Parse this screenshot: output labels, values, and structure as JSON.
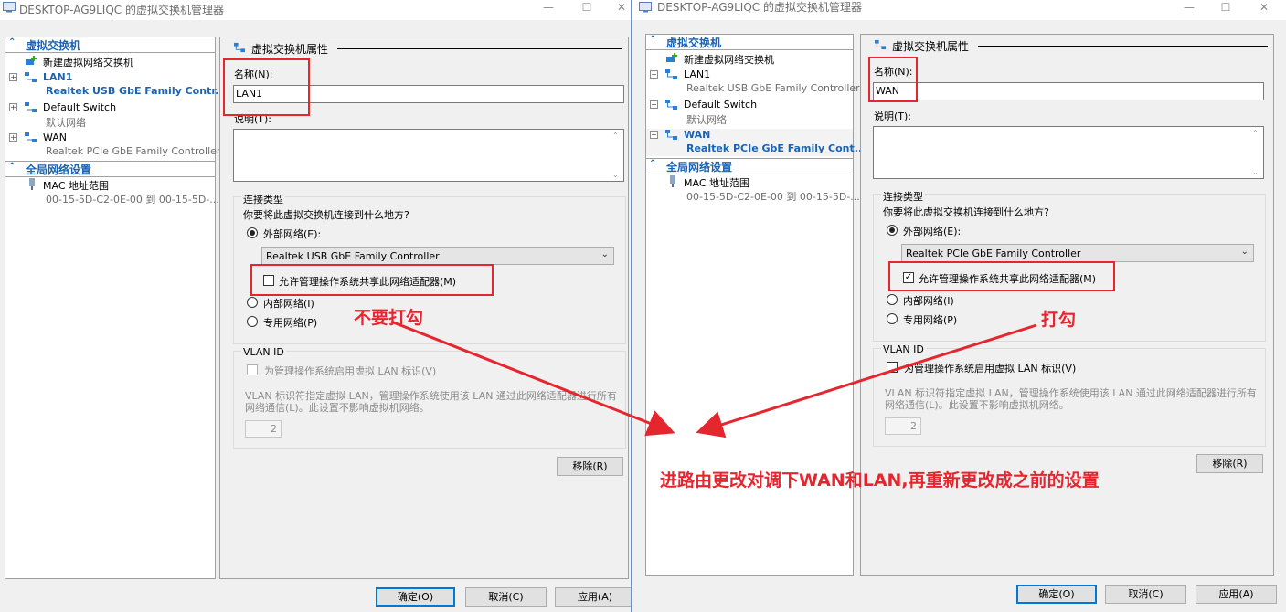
{
  "left": {
    "title": "DESKTOP-AG9LIQC 的虚拟交换机管理器",
    "tree": {
      "section_switches": "虚拟交换机",
      "new_switch": "新建虚拟网络交换机",
      "items": [
        {
          "name": "LAN1",
          "sub": "Realtek USB GbE Family Contr..."
        },
        {
          "name": "Default Switch",
          "sub": "默认网络"
        },
        {
          "name": "WAN",
          "sub": "Realtek PCIe GbE Family Controller"
        }
      ],
      "section_global": "全局网络设置",
      "mac_label": "MAC 地址范围",
      "mac_value": "00-15-5D-C2-0E-00 到 00-15-5D-..."
    },
    "props": {
      "section_title": "虚拟交换机属性",
      "name_label": "名称(N):",
      "name_value": "LAN1",
      "notes_label": "说明(T):",
      "conn_type_label": "连接类型",
      "conn_question": "你要将此虚拟交换机连接到什么地方?",
      "external_label": "外部网络(E):",
      "adapter_value": "Realtek USB GbE Family Controller",
      "allow_share_label": "允许管理操作系统共享此网络适配器(M)",
      "allow_share_checked": false,
      "internal_label": "内部网络(I)",
      "private_label": "专用网络(P)",
      "vlan_title": "VLAN ID",
      "vlan_enable_label": "为管理操作系统启用虚拟 LAN 标识(V)",
      "vlan_desc": "VLAN 标识符指定虚拟 LAN，管理操作系统使用该 LAN 通过此网络适配器进行所有网络通信(L)。此设置不影响虚拟机网络。",
      "vlan_value": "2",
      "remove_btn": "移除(R)"
    },
    "buttons": {
      "ok": "确定(O)",
      "cancel": "取消(C)",
      "apply": "应用(A)"
    }
  },
  "right": {
    "title": "DESKTOP-AG9LIQC 的虚拟交换机管理器",
    "tree": {
      "section_switches": "虚拟交换机",
      "new_switch": "新建虚拟网络交换机",
      "items": [
        {
          "name": "LAN1",
          "sub": "Realtek USB GbE Family Controller"
        },
        {
          "name": "Default Switch",
          "sub": "默认网络"
        },
        {
          "name": "WAN",
          "sub": "Realtek PCIe GbE Family Cont..."
        }
      ],
      "section_global": "全局网络设置",
      "mac_label": "MAC 地址范围",
      "mac_value": "00-15-5D-C2-0E-00 到 00-15-5D-..."
    },
    "props": {
      "section_title": "虚拟交换机属性",
      "name_label": "名称(N):",
      "name_value": "WAN",
      "notes_label": "说明(T):",
      "conn_type_label": "连接类型",
      "conn_question": "你要将此虚拟交换机连接到什么地方?",
      "external_label": "外部网络(E):",
      "adapter_value": "Realtek PCIe GbE Family Controller",
      "allow_share_label": "允许管理操作系统共享此网络适配器(M)",
      "allow_share_checked": true,
      "internal_label": "内部网络(I)",
      "private_label": "专用网络(P)",
      "vlan_title": "VLAN ID",
      "vlan_enable_label": "为管理操作系统启用虚拟 LAN 标识(V)",
      "vlan_desc": "VLAN 标识符指定虚拟 LAN，管理操作系统使用该 LAN 通过此网络适配器进行所有网络通信(L)。此设置不影响虚拟机网络。",
      "vlan_value": "2",
      "remove_btn": "移除(R)"
    },
    "buttons": {
      "ok": "确定(O)",
      "cancel": "取消(C)",
      "apply": "应用(A)"
    }
  },
  "annotations": {
    "no_check": "不要打勾",
    "check": "打勾",
    "note": "进路由更改对调下WAN和LAN,再重新更改成之前的设置"
  },
  "colors": {
    "accent": "#1a63b4",
    "annotation": "#e5262f"
  },
  "icons": {
    "switch": "network-switch-icon",
    "new_switch": "add-switch-icon",
    "mac": "mac-address-icon"
  }
}
